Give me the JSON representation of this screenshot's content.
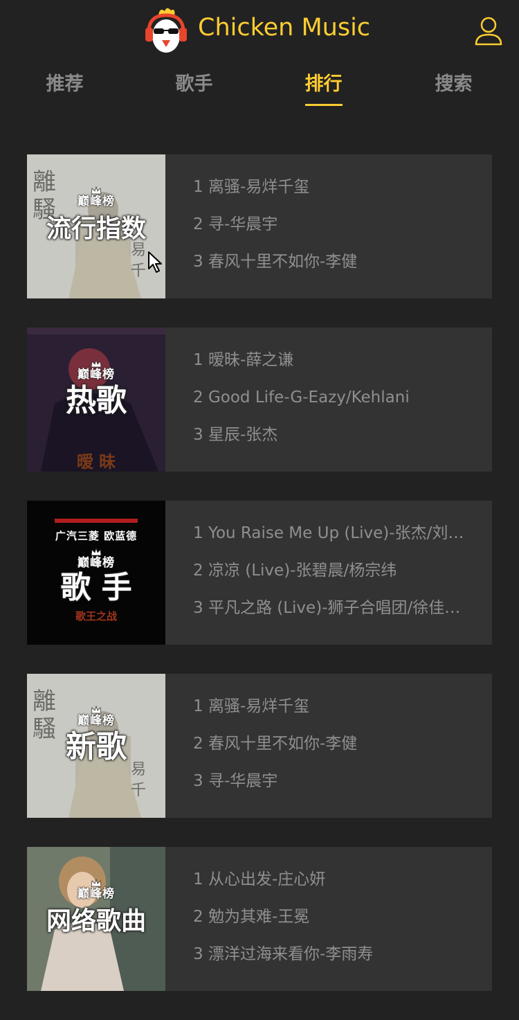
{
  "header": {
    "title": "Chicken Music",
    "accent_color": "#ffcd32",
    "logo_icon": "chicken-logo-icon",
    "user_icon": "user-icon"
  },
  "tabs": [
    {
      "label": "推荐",
      "active": false
    },
    {
      "label": "歌手",
      "active": false
    },
    {
      "label": "排行",
      "active": true
    },
    {
      "label": "搜索",
      "active": false
    }
  ],
  "ranks": [
    {
      "cover_brand": "巅峰榜",
      "cover_title": "流行指数",
      "songs": [
        "1 离骚-易烊千玺",
        "2 寻-华晨宇",
        "3 春风十里不如你-李健"
      ]
    },
    {
      "cover_brand": "巅峰榜",
      "cover_title": "热歌",
      "cover_sub": "暧 昧",
      "songs": [
        "1 暧昧-薛之谦",
        "2 Good Life-G-Eazy/Kehlani",
        "3 星辰-张杰"
      ]
    },
    {
      "cover_brand": "巅峰榜",
      "cover_title": "歌 手",
      "cover_top": "广汽三菱 欧蓝德",
      "cover_sub": "歌王之战",
      "songs": [
        "1 You Raise Me Up (Live)-张杰/刘…",
        "2 凉凉 (Live)-张碧晨/杨宗纬",
        "3 平凡之路 (Live)-狮子合唱团/徐佳…"
      ]
    },
    {
      "cover_brand": "巅峰榜",
      "cover_title": "新歌",
      "songs": [
        "1 离骚-易烊千玺",
        "2 春风十里不如你-李健",
        "3 寻-华晨宇"
      ]
    },
    {
      "cover_brand": "巅峰榜",
      "cover_title": "网络歌曲",
      "songs": [
        "1 从心出发-庄心妍",
        "2 勉为其难-王冕",
        "3 漂洋过海来看你-李雨寿"
      ]
    }
  ]
}
